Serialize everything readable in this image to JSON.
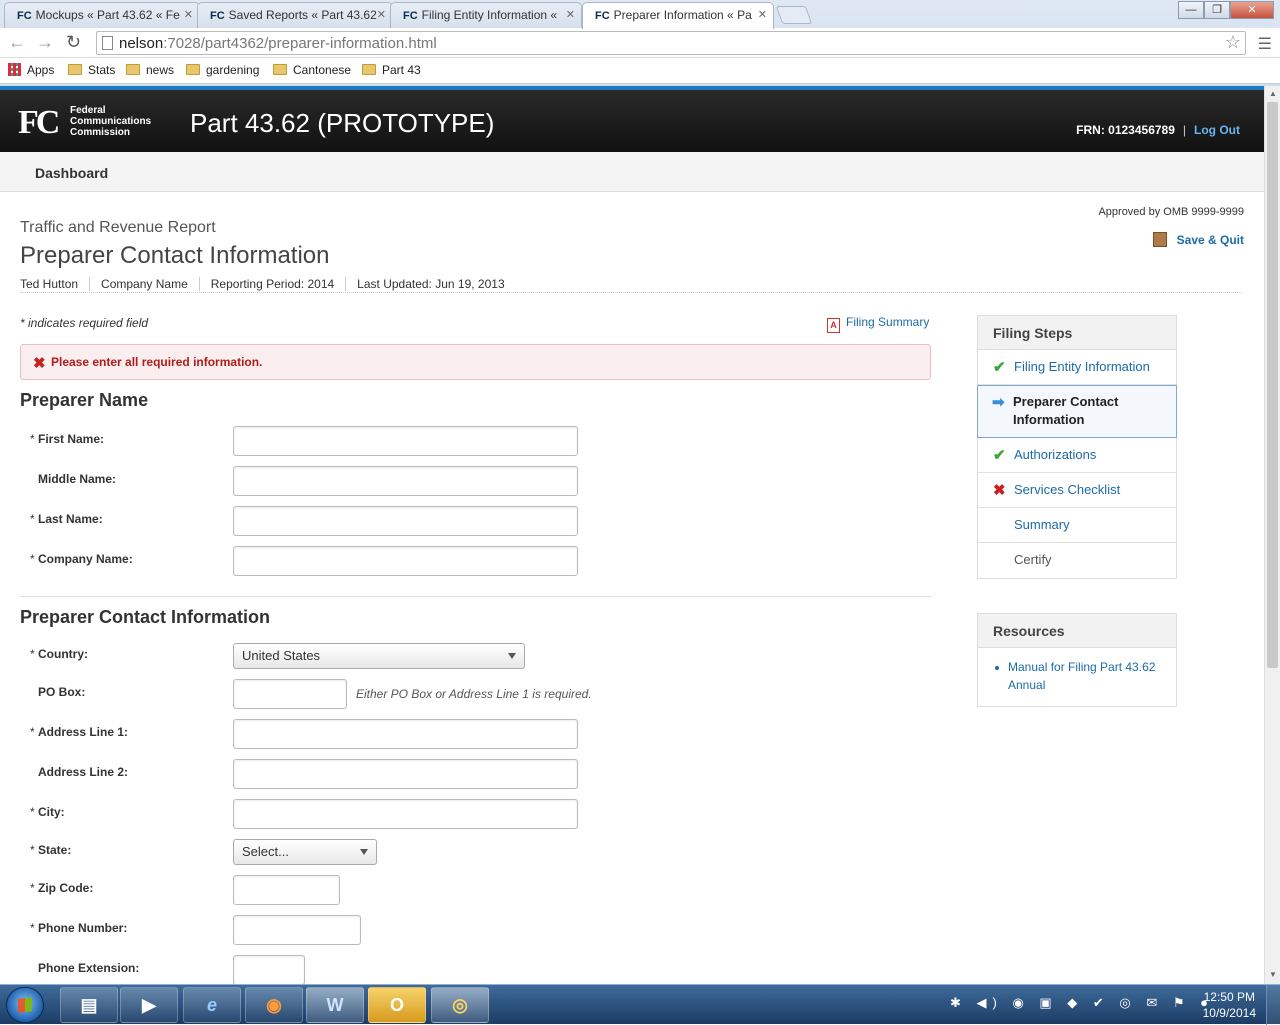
{
  "browser": {
    "tabs": [
      {
        "favicon": "FC",
        "label": "Mockups « Part 43.62 « Fe"
      },
      {
        "favicon": "FC",
        "label": "Saved Reports « Part 43.62"
      },
      {
        "favicon": "FC",
        "label": "Filing Entity Information «"
      },
      {
        "favicon": "FC",
        "label": "Preparer Information « Pa"
      }
    ],
    "url_host": "nelson",
    "url_path": ":7028/part4362/preparer-information.html",
    "bookmarks": [
      "Apps",
      "Stats",
      "news",
      "gardening",
      "Cantonese",
      "Part 43"
    ],
    "window_controls": {
      "minimize": "—",
      "restore": "❐",
      "close": "✕"
    }
  },
  "header": {
    "logo_mark": "FC",
    "logo_text": [
      "Federal",
      "Communications",
      "Commission"
    ],
    "app_title": "Part 43.62 (PROTOTYPE)",
    "frn": "FRN: 0123456789",
    "separator": "|",
    "logout": "Log Out"
  },
  "subnav": {
    "dashboard": "Dashboard"
  },
  "page": {
    "omb": "Approved by OMB 9999-9999",
    "save_quit": "Save & Quit",
    "kicker": "Traffic and Revenue Report",
    "title": "Preparer Contact Information",
    "meta": [
      "Ted Hutton",
      "Company Name",
      "Reporting Period: 2014",
      "Last Updated: Jun 19, 2013"
    ],
    "required_note": "* indicates required field",
    "filing_summary": "Filing Summary",
    "error": "Please enter all required information."
  },
  "form": {
    "required_mark": "*",
    "name_section": "Preparer Name",
    "first_name": "First Name:",
    "middle_name": "Middle Name:",
    "last_name": "Last Name:",
    "company_name": "Company Name:",
    "contact_section": "Preparer Contact Information",
    "country": "Country:",
    "country_value": "United States",
    "po_box": "PO Box:",
    "po_hint": "Either PO Box or Address Line 1 is required.",
    "address1": "Address Line 1:",
    "address2": "Address Line 2:",
    "city": "City:",
    "state": "State:",
    "state_value": "Select...",
    "zip": "Zip Code:",
    "phone": "Phone Number:",
    "phone_ext": "Phone Extension:"
  },
  "sidebar": {
    "steps_title": "Filing Steps",
    "steps": [
      {
        "label": "Filing Entity Information",
        "status": "complete",
        "icon": "check-icon"
      },
      {
        "label": "Preparer Contact Information",
        "status": "current",
        "icon": "arrow-right-icon"
      },
      {
        "label": "Authorizations",
        "status": "complete",
        "icon": "check-icon"
      },
      {
        "label": "Services Checklist",
        "status": "error",
        "icon": "x-icon"
      },
      {
        "label": "Summary",
        "status": "pending",
        "icon": ""
      },
      {
        "label": "Certify",
        "status": "disabled",
        "icon": ""
      }
    ],
    "resources_title": "Resources",
    "resources": [
      "Manual for Filing Part 43.62 Annual"
    ]
  },
  "taskbar": {
    "apps": [
      "explorer-icon",
      "media-player-icon",
      "internet-explorer-icon",
      "firefox-icon",
      "word-icon",
      "outlook-icon",
      "chrome-icon"
    ],
    "app_glyphs": [
      "▤",
      "▶",
      "e",
      "◉",
      "W",
      "O",
      "◎"
    ],
    "tray": "✱ ◀) ◉ ▣ ◆ ✔ ◎ ✉ ⚑ ●",
    "time": "12:50 PM",
    "date": "10/9/2014"
  },
  "colors": {
    "accent": "#1c6ba8",
    "header_bg": "#111111",
    "error": "#c92020",
    "success": "#3aa53a"
  }
}
